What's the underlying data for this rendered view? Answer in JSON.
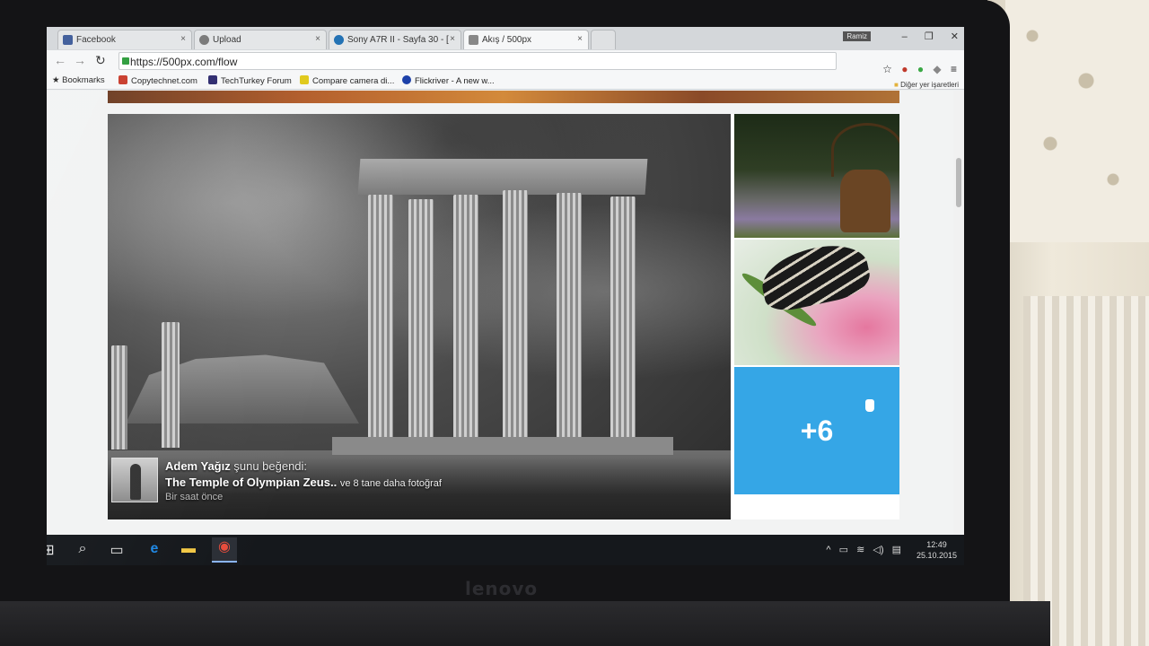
{
  "browser": {
    "tabs": [
      {
        "label": "Facebook",
        "favicon_color": "#3b5998"
      },
      {
        "label": "Upload",
        "favicon_color": "#666666"
      },
      {
        "label": "Sony A7R II - Sayfa 30 - [",
        "favicon_color": "#1f6fb3"
      },
      {
        "label": "Akış / 500px",
        "favicon_color": "#777777",
        "active": true
      }
    ],
    "tab_close_glyph": "×",
    "profile_name": "Ramiz",
    "window_controls": [
      "–",
      "❐",
      "✕"
    ],
    "url": "https://500px.com/flow",
    "nav_glyphs": {
      "back": "←",
      "forward": "→",
      "reload": "↻"
    },
    "bookmarks": [
      {
        "label": "Bookmarks",
        "icon": "star-icon"
      },
      {
        "label": "Copytechnet.com",
        "icon_color": "#c83a2a"
      },
      {
        "label": "TechTurkey Forum",
        "icon_color": "#2d2a6e"
      },
      {
        "label": "Compare camera di...",
        "icon_color": "#e0c91a"
      },
      {
        "label": "Flickriver - A new w...",
        "icon_color": "#1b3fa8"
      }
    ],
    "other_bookmarks": "Diğer yer işaretleri",
    "star_glyph": "☆",
    "menu_glyph": "≡"
  },
  "feed": {
    "liker_name": "Adem Yağız",
    "liker_action": "şunu beğendi:",
    "photo_title": "The Temple of Olympian Zeus..",
    "photo_more": "ve 8 tane daha fotoğraf",
    "time_ago": "Bir saat önce",
    "more_count": "+6"
  },
  "taskbar": {
    "tray_glyphs": [
      "^",
      "▭",
      "≋",
      "◁)",
      "▤"
    ],
    "time": "12:49",
    "date": "25.10.2015"
  },
  "device": {
    "brand": "lenovo"
  }
}
